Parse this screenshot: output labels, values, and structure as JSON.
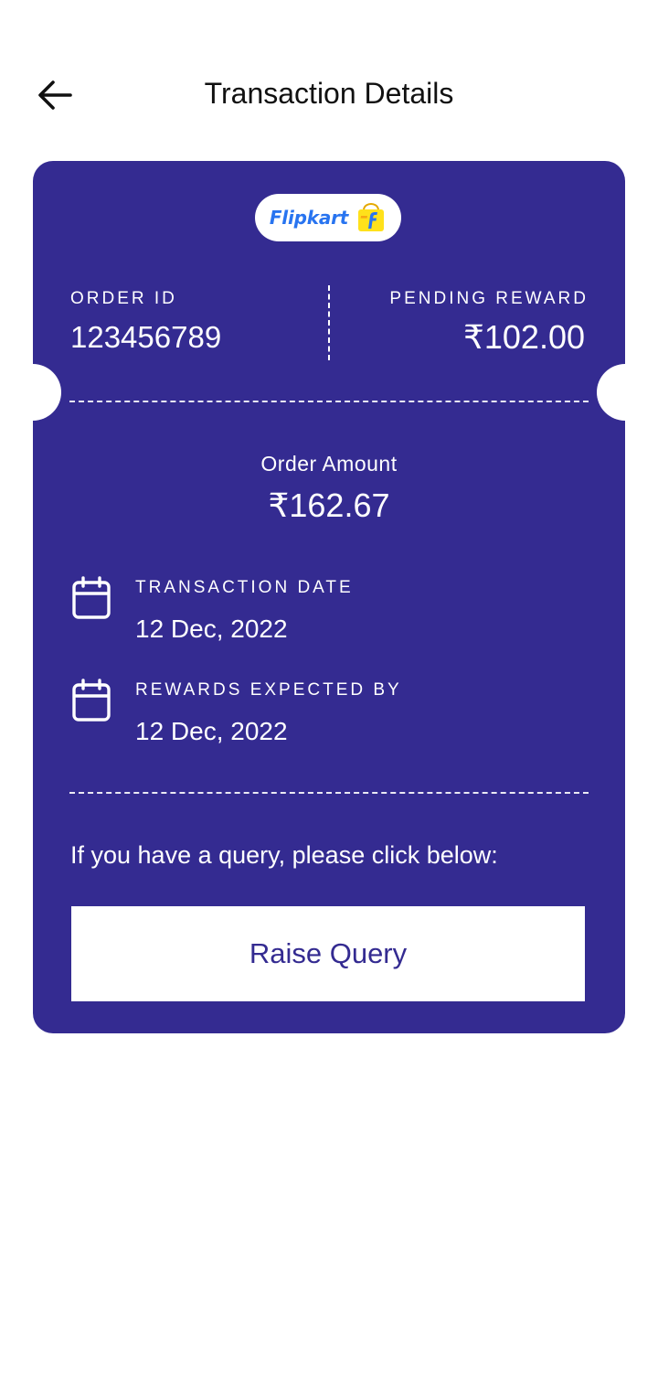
{
  "header": {
    "title": "Transaction Details"
  },
  "merchant": {
    "name": "Flipkart"
  },
  "order": {
    "id_label": "ORDER ID",
    "id_value": "123456789",
    "reward_label": "PENDING REWARD",
    "reward_value": "₹102.00",
    "amount_label": "Order Amount",
    "amount_value": "₹162.67"
  },
  "dates": {
    "transaction_label": "TRANSACTION DATE",
    "transaction_value": "12 Dec, 2022",
    "expected_label": "REWARDS EXPECTED BY",
    "expected_value": "12 Dec, 2022"
  },
  "query": {
    "prompt": "If you have a query, please click below:",
    "button_label": "Raise Query"
  },
  "colors": {
    "card_background": "#342b91",
    "brand_blue": "#2874f0",
    "brand_yellow": "#ffe11b"
  },
  "icons": {
    "back": "arrow-left-icon",
    "calendar": "calendar-icon"
  }
}
